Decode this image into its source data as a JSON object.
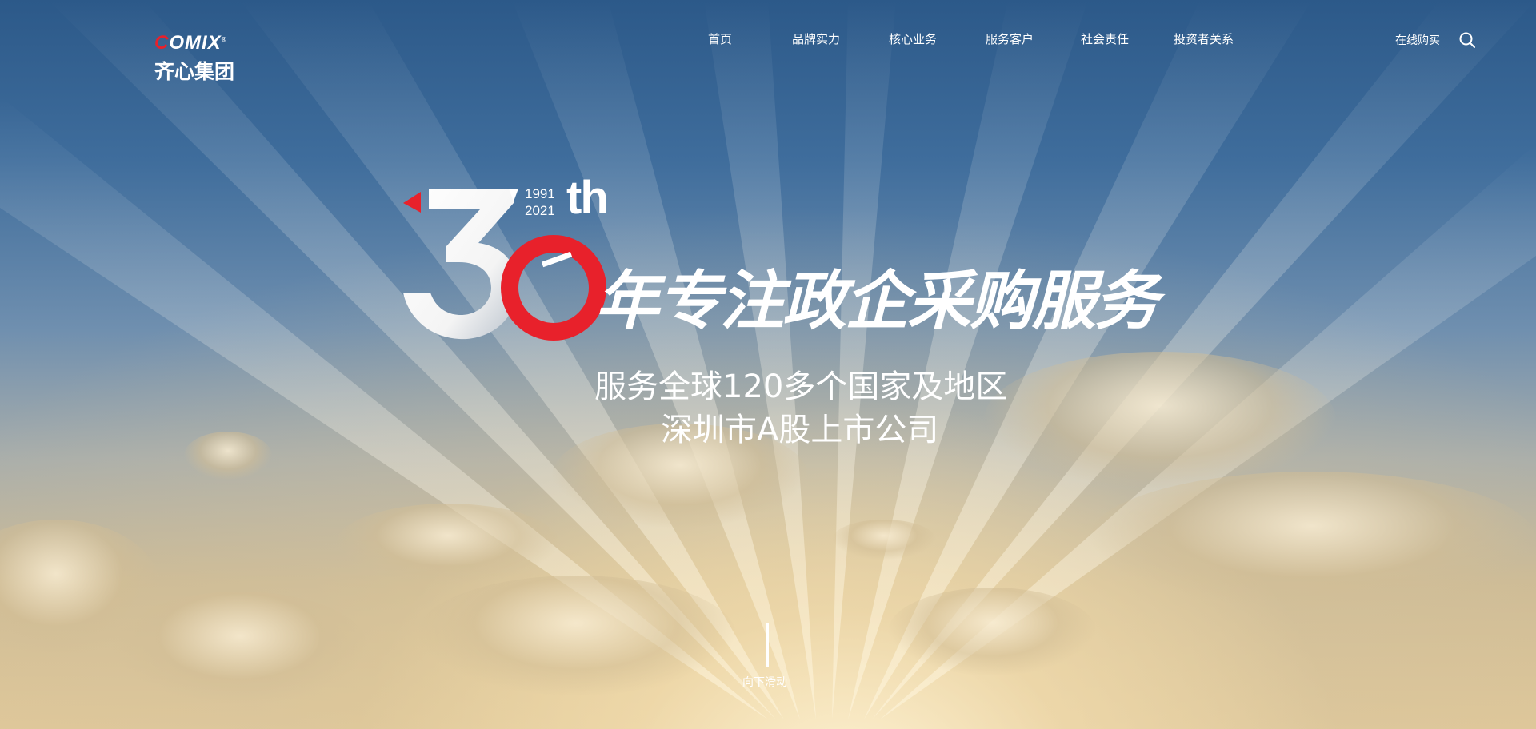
{
  "brand": {
    "logo_en": "OMIX",
    "logo_cn": "齐心集团",
    "accent_color": "#e8212b"
  },
  "nav": {
    "items": [
      "首页",
      "品牌实力",
      "核心业务",
      "服务客户",
      "社会责任",
      "投资者关系"
    ]
  },
  "header": {
    "buy_label": "在线购买",
    "search_icon": "search-icon"
  },
  "hero": {
    "year_start": "1991",
    "year_end": "2021",
    "th": "th",
    "headline": "年专注政企采购服务",
    "subline_1": "服务全球120多个国家及地区",
    "subline_2": "深圳市A股上市公司",
    "scroll_label": "向下滑动"
  }
}
